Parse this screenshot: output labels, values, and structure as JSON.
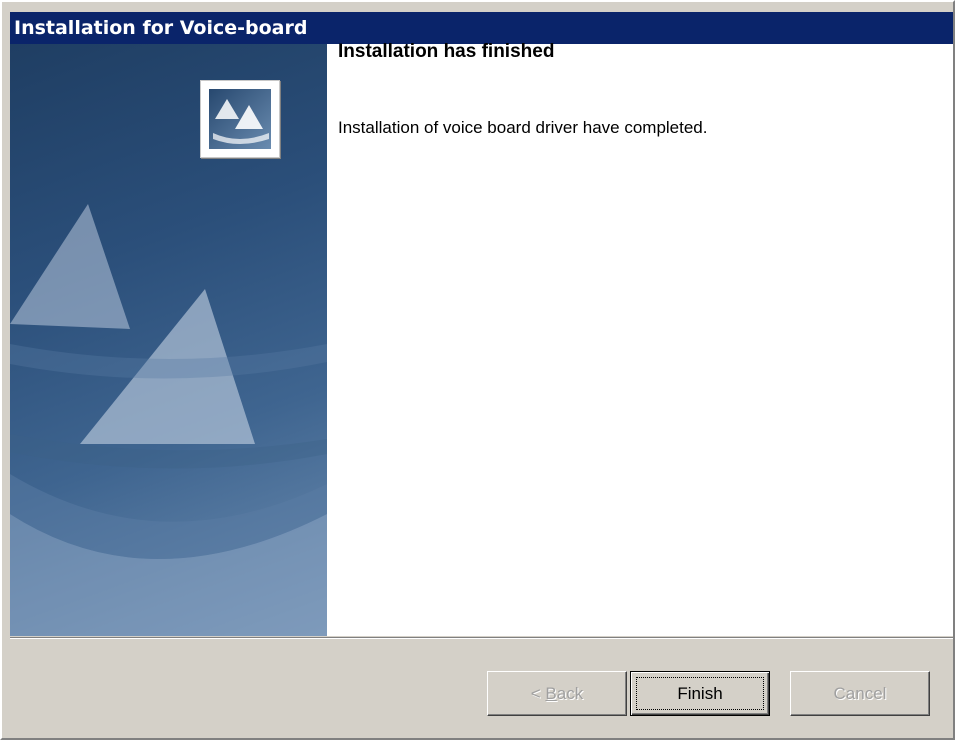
{
  "window": {
    "title": "Installation for Voice-board"
  },
  "main": {
    "heading": "Installation has finished",
    "message": "Installation of voice board driver have completed."
  },
  "buttons": {
    "back": {
      "prefix": "< ",
      "mnemonic": "B",
      "rest": "ack",
      "enabled": false
    },
    "finish": {
      "label": "Finish",
      "enabled": true,
      "default": true
    },
    "cancel": {
      "label": "Cancel",
      "enabled": false
    }
  },
  "colors": {
    "titlebar": "#0a246a",
    "sidebar_dark": "#1f3e63",
    "sidebar_light": "#6f8fb2",
    "face": "#d4d0c8"
  },
  "icons": {
    "logo": "sail-logo-icon",
    "sidebar_art": "sailboat-decorative-icon"
  }
}
